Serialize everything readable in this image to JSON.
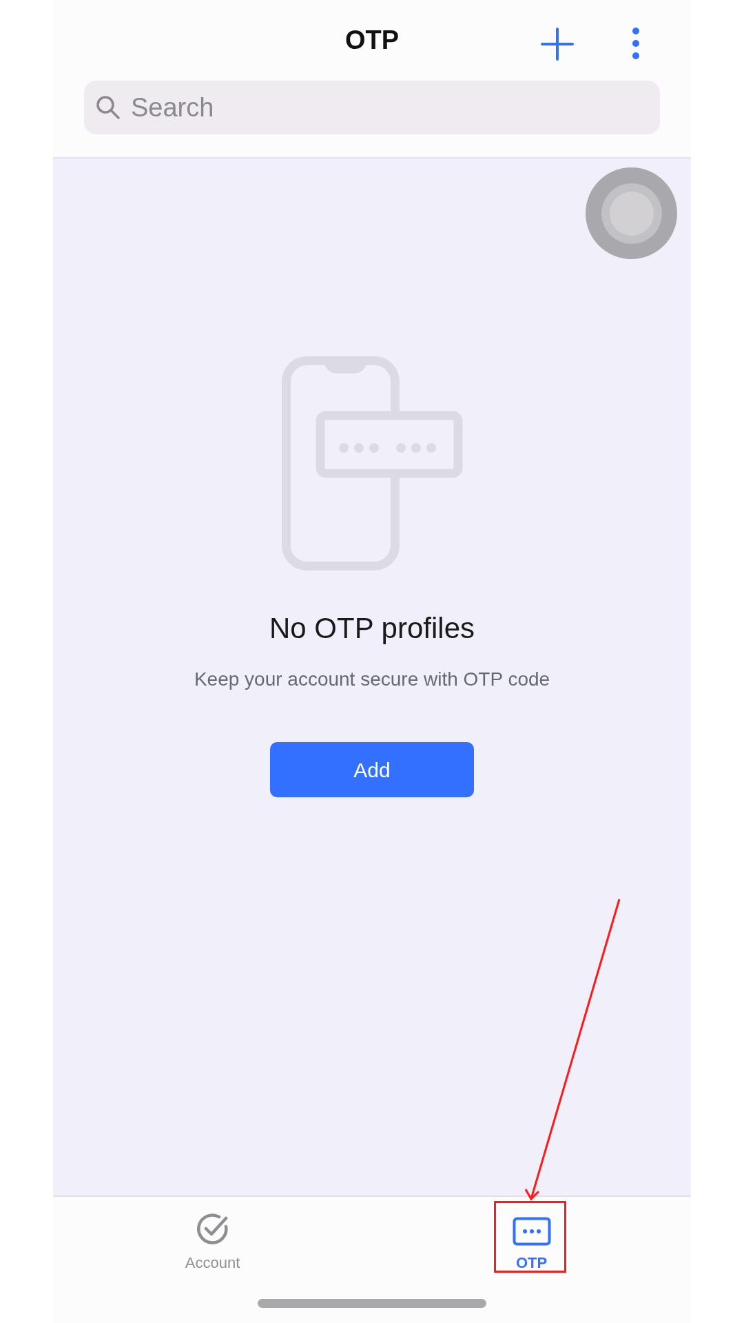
{
  "header": {
    "title": "OTP"
  },
  "search": {
    "placeholder": "Search"
  },
  "empty_state": {
    "title": "No OTP profiles",
    "message": "Keep your account secure with OTP code",
    "button": "Add"
  },
  "tabs": [
    {
      "label": "Account",
      "kind": "account",
      "selected": false
    },
    {
      "label": "OTP",
      "kind": "otp",
      "selected": true
    }
  ]
}
